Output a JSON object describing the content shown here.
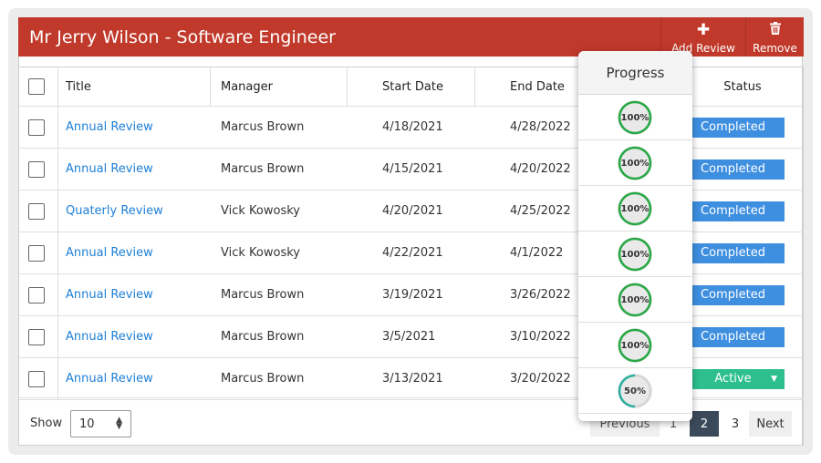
{
  "header": {
    "title": "Mr Jerry Wilson - Software Engineer",
    "add_label": "Add Review",
    "remove_label": "Remove"
  },
  "table": {
    "columns": [
      "Title",
      "Manager",
      "Start Date",
      "End Date",
      "Progress",
      "Status"
    ],
    "rows": [
      {
        "title": "Annual Review",
        "manager": "Marcus Brown",
        "start": "4/18/2021",
        "end": "4/28/2022",
        "progress": 100,
        "progress_label": "100%",
        "status": "Completed"
      },
      {
        "title": "Annual Review",
        "manager": "Marcus Brown",
        "start": "4/15/2021",
        "end": "4/20/2022",
        "progress": 100,
        "progress_label": "100%",
        "status": "Completed"
      },
      {
        "title": "Quaterly Review",
        "manager": "Vick Kowosky",
        "start": "4/20/2021",
        "end": "4/25/2022",
        "progress": 100,
        "progress_label": "100%",
        "status": "Completed"
      },
      {
        "title": "Annual Review",
        "manager": "Vick Kowosky",
        "start": "4/22/2021",
        "end": "4/1/2022",
        "progress": 100,
        "progress_label": "100%",
        "status": "Completed"
      },
      {
        "title": "Annual Review",
        "manager": "Marcus Brown",
        "start": "3/19/2021",
        "end": "3/26/2022",
        "progress": 100,
        "progress_label": "100%",
        "status": "Completed"
      },
      {
        "title": "Annual Review",
        "manager": "Marcus Brown",
        "start": "3/5/2021",
        "end": "3/10/2022",
        "progress": 100,
        "progress_label": "100%",
        "status": "Completed"
      },
      {
        "title": "Annual Review",
        "manager": "Marcus Brown",
        "start": "3/13/2021",
        "end": "3/20/2022",
        "progress": 50,
        "progress_label": "50%",
        "status": "Active"
      }
    ]
  },
  "footer": {
    "show_label": "Show",
    "page_size": "10",
    "pagination": {
      "previous": "Previous",
      "pages": [
        "1",
        "2",
        "3"
      ],
      "current": "2",
      "next": "Next"
    }
  },
  "colors": {
    "header_bg": "#c0392b",
    "completed": "#3e8fe0",
    "active": "#2dbf8e",
    "progress_full": "#27a844",
    "progress_partial": "#2ab0a0",
    "link": "#1e7fd6"
  },
  "icons": {
    "add": "plus-icon",
    "remove": "trash-icon",
    "select": "sort-arrows-icon",
    "status_dropdown": "caret-down-icon"
  }
}
